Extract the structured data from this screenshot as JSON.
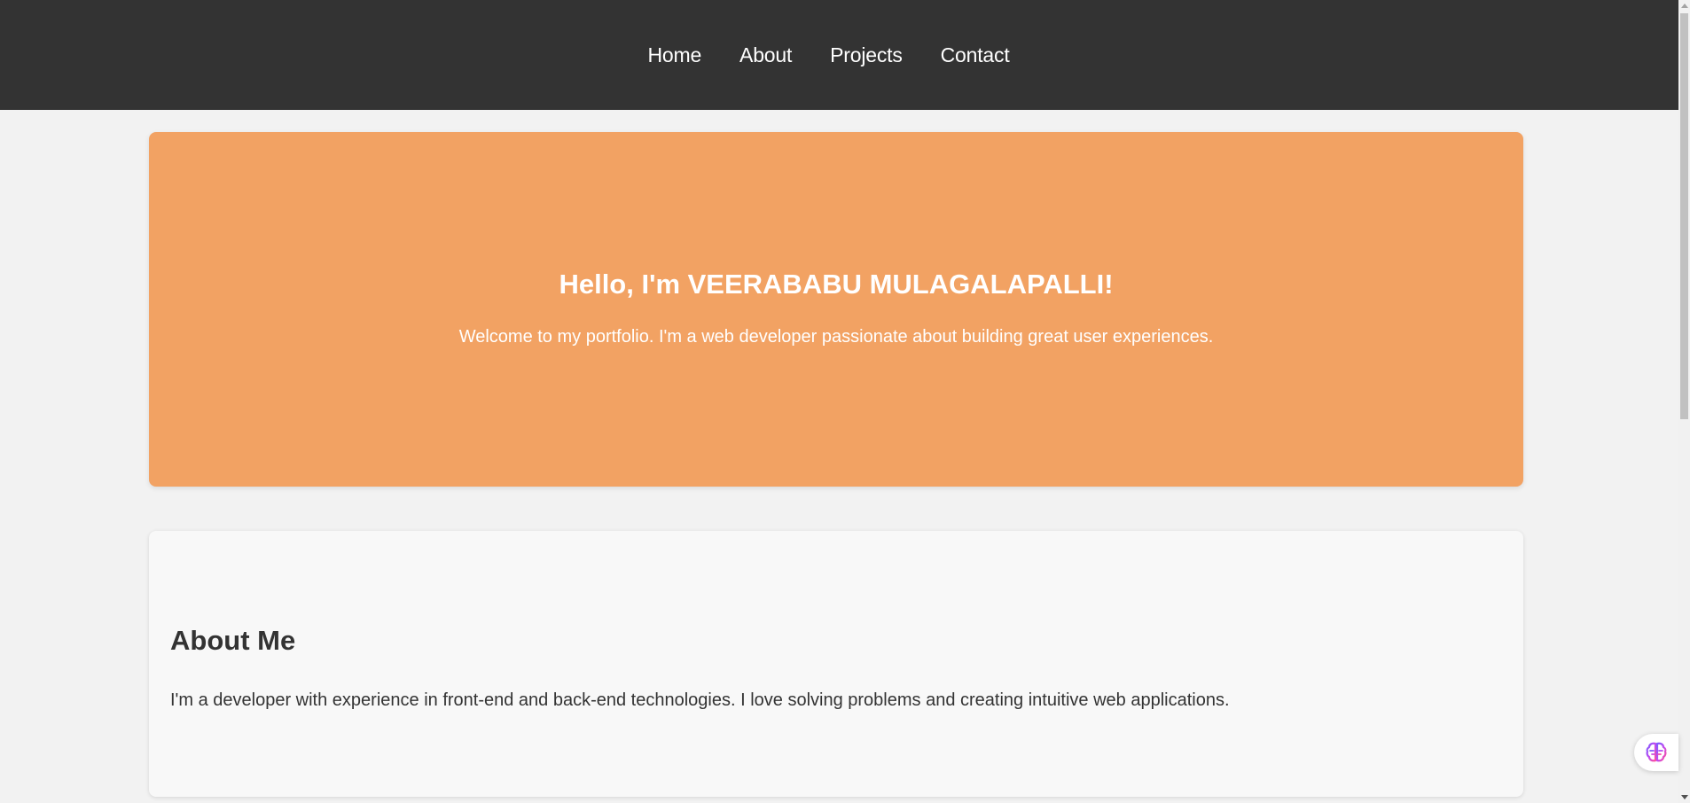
{
  "nav": {
    "items": [
      {
        "label": "Home"
      },
      {
        "label": "About"
      },
      {
        "label": "Projects"
      },
      {
        "label": "Contact"
      }
    ]
  },
  "hero": {
    "title": "Hello, I'm VEERABABU MULAGALAPALLI!",
    "subtitle": "Welcome to my portfolio. I'm a web developer passionate about building great user experiences."
  },
  "about": {
    "title": "About Me",
    "text": "I'm a developer with experience in front-end and back-end technologies. I love solving problems and creating intuitive web applications."
  },
  "widget": {
    "icon": "brain-icon"
  },
  "colors": {
    "nav_background": "#333333",
    "hero_background": "#f2a263",
    "page_background": "#f2f2f2",
    "card_background": "#f8f8f8",
    "text": "#333333"
  }
}
